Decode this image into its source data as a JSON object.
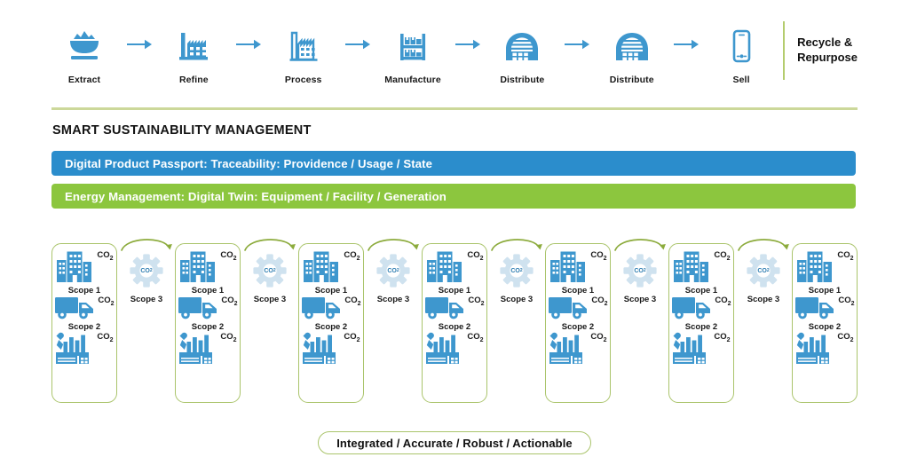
{
  "colors": {
    "blue": "#2b8dcc",
    "icon_blue": "#3e97ce",
    "green": "#8cc63e",
    "border_green": "#aac46b",
    "rule_green": "#ccd89a",
    "gear_grey_blue": "#cfe2ef",
    "text": "#181818"
  },
  "chain": {
    "steps": [
      {
        "label": "Extract",
        "icon": "ore-cart-icon"
      },
      {
        "label": "Refine",
        "icon": "refinery-icon"
      },
      {
        "label": "Process",
        "icon": "factory-outline-icon"
      },
      {
        "label": "Manufacture",
        "icon": "racking-shelf-icon"
      },
      {
        "label": "Distribute",
        "icon": "warehouse-icon"
      },
      {
        "label": "Distribute",
        "icon": "warehouse-icon"
      },
      {
        "label": "Sell",
        "icon": "smartphone-icon"
      }
    ],
    "arrow_icon": "right-arrow-icon",
    "endcap": "Recycle &\nRepurpose"
  },
  "section": {
    "title": "SMART SUSTAINABILITY MANAGEMENT"
  },
  "banners": [
    {
      "text": "Digital Product Passport: Traceability: Providence / Usage / State"
    },
    {
      "text": "Energy Management: Digital Twin: Equipment / Facility / Generation"
    }
  ],
  "scope_card": {
    "rows": [
      {
        "icon": "office-buildings-icon",
        "co2": "CO",
        "sub": "2",
        "label": "Scope 1"
      },
      {
        "icon": "delivery-truck-icon",
        "co2": "CO",
        "sub": "2",
        "label": "Scope 2"
      },
      {
        "icon": "factory-icon",
        "co2": "CO",
        "sub": "2",
        "label": ""
      }
    ]
  },
  "gear_node": {
    "icon": "gear-icon",
    "arc_icon": "curved-arrow-icon",
    "co2": "CO",
    "sub": "2",
    "label": "Scope 3"
  },
  "scope_row": {
    "card_count": 7,
    "gear_count": 6
  },
  "pill": {
    "text": "Integrated / Accurate / Robust / Actionable"
  }
}
